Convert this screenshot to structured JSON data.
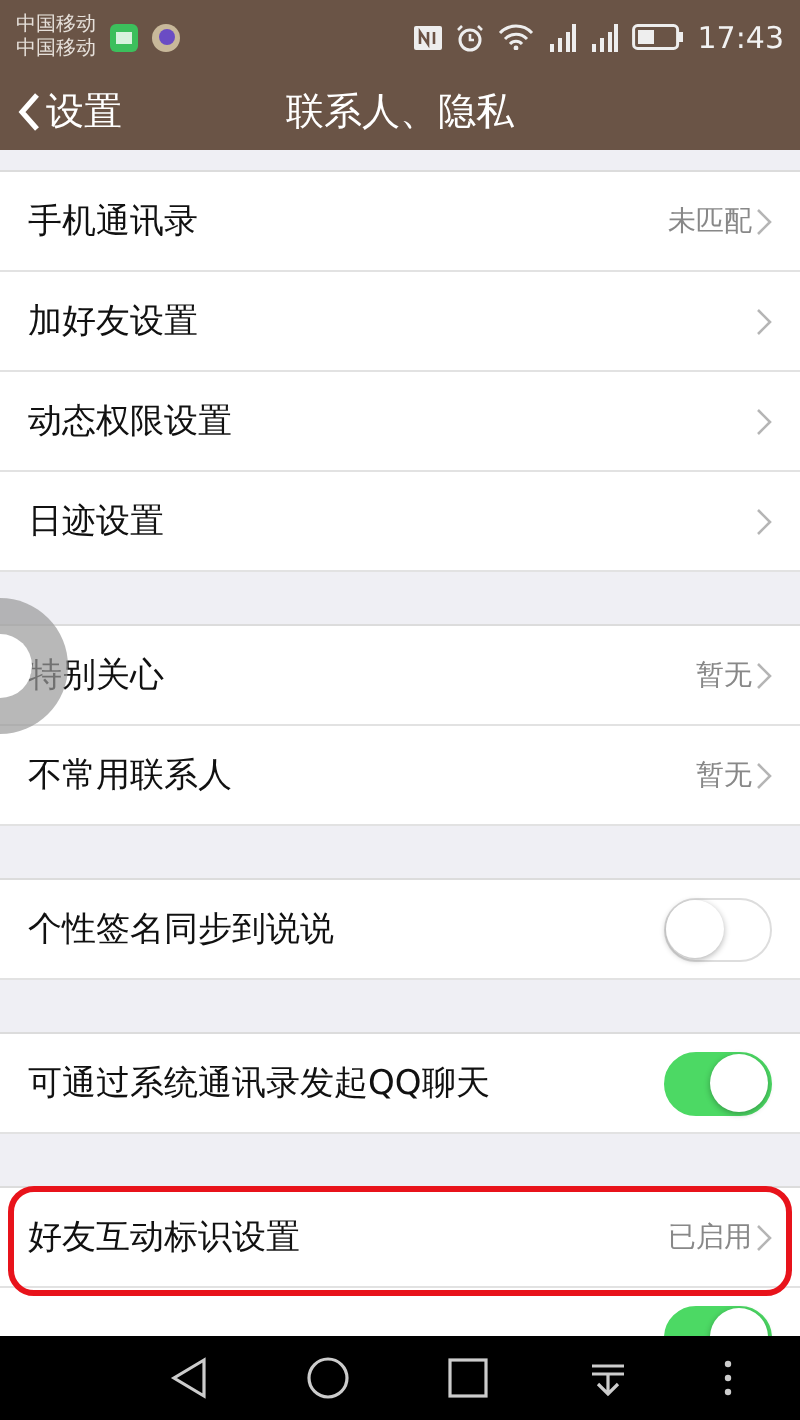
{
  "status_bar": {
    "carriers": [
      "中国移动",
      "中国移动"
    ],
    "time": "17:43"
  },
  "header": {
    "back_label": "设置",
    "title": "联系人、隐私"
  },
  "sections": [
    {
      "items": [
        {
          "kind": "link",
          "label": "手机通讯录",
          "value": "未匹配",
          "highlighted": false
        },
        {
          "kind": "link",
          "label": "加好友设置",
          "highlighted": false
        },
        {
          "kind": "link",
          "label": "动态权限设置",
          "highlighted": false
        },
        {
          "kind": "link",
          "label": "日迹设置",
          "highlighted": false
        }
      ]
    },
    {
      "items": [
        {
          "kind": "link",
          "label": "特别关心",
          "value": "暂无",
          "highlighted": false
        },
        {
          "kind": "link",
          "label": "不常用联系人",
          "value": "暂无",
          "highlighted": false
        }
      ]
    },
    {
      "items": [
        {
          "kind": "toggle",
          "label": "个性签名同步到说说",
          "on": false
        }
      ]
    },
    {
      "items": [
        {
          "kind": "toggle",
          "label": "可通过系统通讯录发起QQ聊天",
          "on": true
        }
      ]
    },
    {
      "items": [
        {
          "kind": "link",
          "label": "好友互动标识设置",
          "value": "已启用",
          "highlighted": true
        },
        {
          "kind": "toggle",
          "on": true
        }
      ]
    }
  ]
}
